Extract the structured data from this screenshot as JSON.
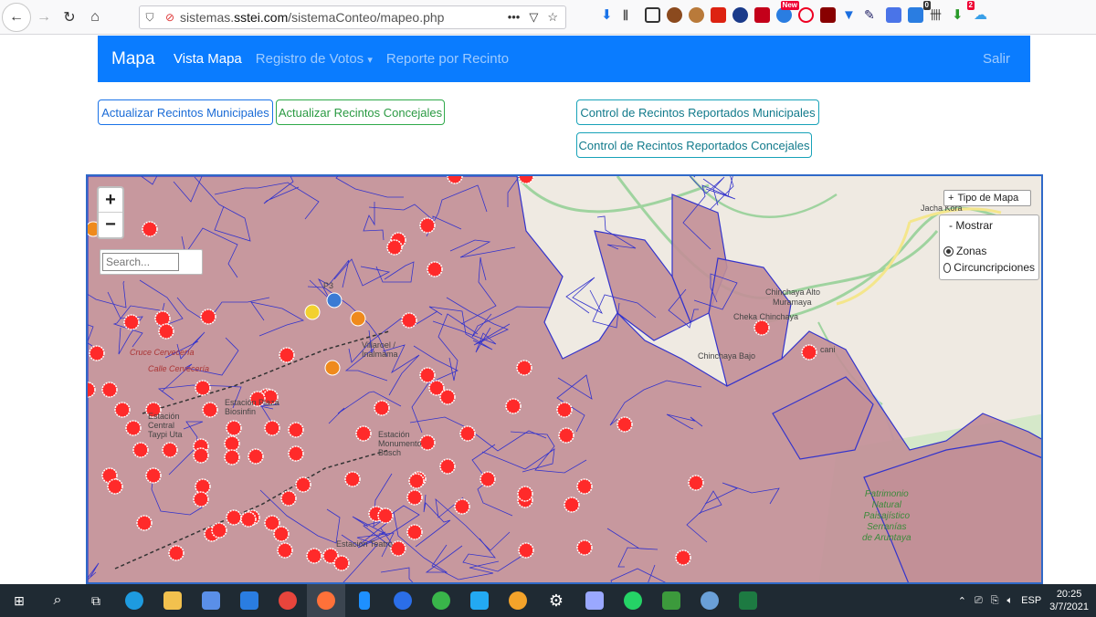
{
  "browser": {
    "url_prefix": "sistemas.",
    "url_domain": "sstei.com",
    "url_path": "/sistemaConteo/mapeo.php",
    "new_badge": "New",
    "badge_count_1": "0",
    "badge_count_2": "2"
  },
  "navbar": {
    "brand": "Mapa",
    "items": [
      "Vista Mapa",
      "Registro de Votos",
      "Reporte por Recinto"
    ],
    "dropdown_caret": "▾",
    "logout": "Salir"
  },
  "buttons": {
    "update_municipal": "Actualizar Recintos Municipales",
    "update_concejales": "Actualizar Recintos Concejales",
    "control_municipal": "Control de Recintos Reportados Municipales",
    "control_concejales": "Control de Recintos Reportados Concejales"
  },
  "map": {
    "zoom_in": "+",
    "zoom_out": "−",
    "search_placeholder": "Search...",
    "map_type_label": "Tipo de Mapa",
    "layer_title": "Mostrar",
    "layer_options": [
      "Zonas",
      "Circuncripciones"
    ],
    "selected_layer": "Zonas",
    "labels": {
      "jacha_kora": "Jacha Kora",
      "chinchaya_alto": "Chinchaya Alto",
      "muramaya": "Muramaya",
      "cheka": "Cheka Chinchaya",
      "chinchaya_bajo": "Chinchaya Bajo",
      "caldo_cani": "cani",
      "cruce": "Cruce Cervecería",
      "calle": "Calle Cervecería",
      "villaroel": "Villaroel / Inalmama",
      "biosinfin": "Estación Plaza Biosinfin",
      "monumento": "Estación Monumento Busch",
      "pararaijo": "Estación Central Taypi Uta",
      "teatro": "Estación Teatro",
      "pj": "P3"
    },
    "park_label": [
      "Patrimonio",
      "Natural",
      "Paisajístico",
      "Serranías",
      "de Aruntaya"
    ],
    "colors": {
      "zone_fill": "#c28f97",
      "zone_stroke": "#3333cc",
      "marker_red": "#ff2a2a",
      "marker_orange": "#ef8a1c",
      "marker_yellow": "#f2d12f",
      "marker_blue": "#3b7bd4"
    }
  },
  "taskbar": {
    "time": "20:25",
    "date": "3/7/2021",
    "lang": "ESP"
  }
}
